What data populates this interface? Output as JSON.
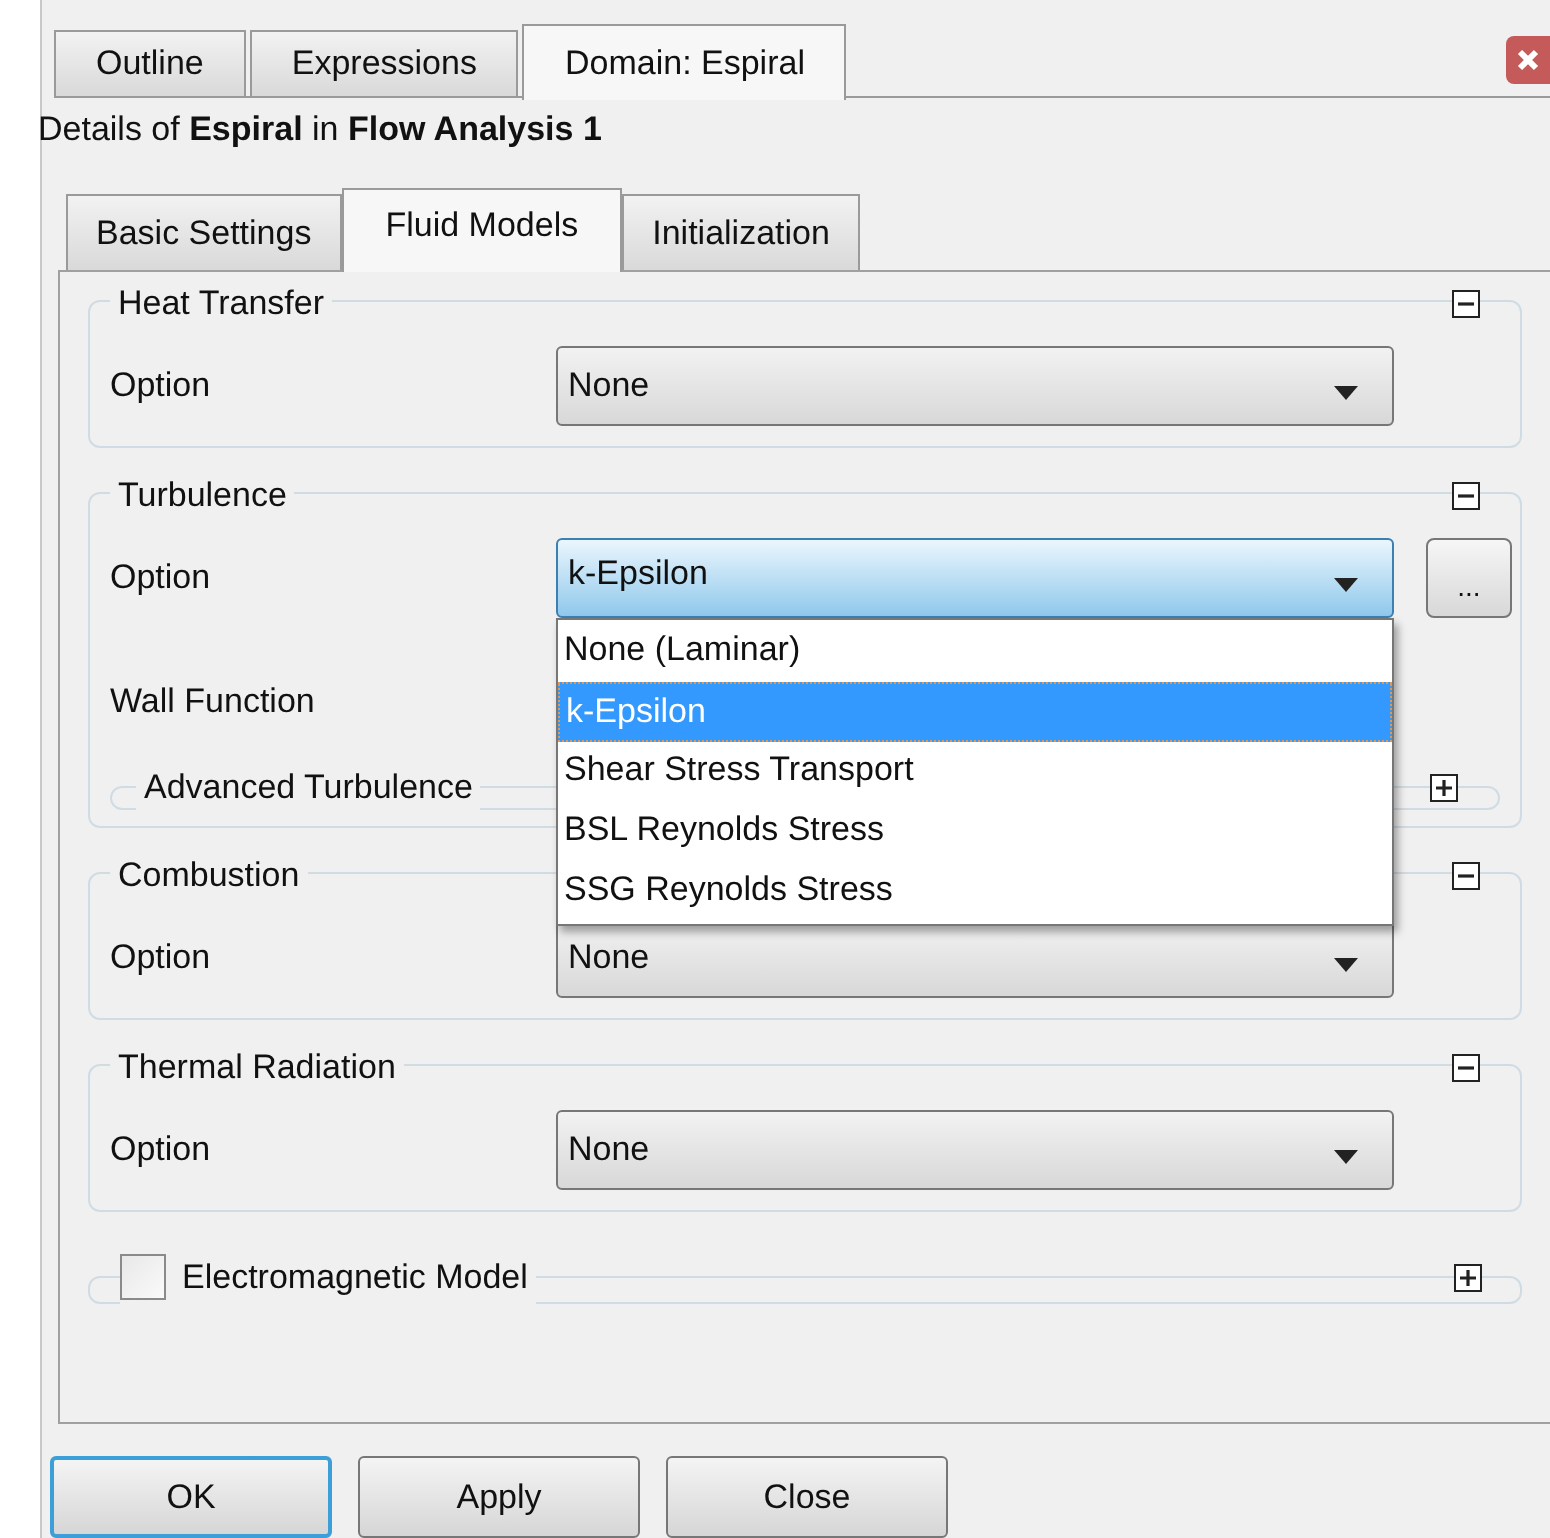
{
  "tabs": [
    {
      "label": "Outline",
      "selected": false
    },
    {
      "label": "Expressions",
      "selected": false
    },
    {
      "label": "Domain: Espiral",
      "selected": true
    }
  ],
  "details": "Details of **Espiral** in **Flow Analysis 1**",
  "subtabs": [
    {
      "label": "Basic Settings",
      "selected": false
    },
    {
      "label": "Fluid Models",
      "selected": true
    },
    {
      "label": "Initialization",
      "selected": false
    }
  ],
  "groups": [
    {
      "kind": "options",
      "title": "Heat Transfer",
      "expanded": true,
      "rows": [
        {
          "kind": "combo",
          "label": "Option",
          "value": "None",
          "focused": false
        }
      ]
    },
    {
      "kind": "options",
      "title": "Turbulence",
      "expanded": true,
      "rows": [
        {
          "kind": "combo",
          "label": "Option",
          "value": "k-Epsilon",
          "focused": true,
          "extra_button": "...",
          "dropdown": [
            {
              "label": "None (Laminar)",
              "selected": false
            },
            {
              "label": "k-Epsilon",
              "selected": true
            },
            {
              "label": "Shear Stress Transport",
              "selected": false
            },
            {
              "label": "BSL Reynolds Stress",
              "selected": false
            },
            {
              "label": "SSG Reynolds Stress",
              "selected": false
            }
          ]
        },
        {
          "kind": "label",
          "label": "Wall Function"
        }
      ],
      "subgroup": {
        "title": "Advanced Turbulence",
        "expanded": false
      }
    },
    {
      "kind": "options",
      "title": "Combustion",
      "expanded": true,
      "rows": [
        {
          "kind": "combo",
          "label": "Option",
          "value": "None",
          "focused": false
        }
      ]
    },
    {
      "kind": "options",
      "title": "Thermal Radiation",
      "expanded": true,
      "rows": [
        {
          "kind": "combo",
          "label": "Option",
          "value": "None",
          "focused": false
        }
      ]
    },
    {
      "kind": "checkbox",
      "title": "Electromagnetic Model",
      "checked": false,
      "expanded": false
    }
  ],
  "buttons": [
    {
      "label": "OK",
      "default": true
    },
    {
      "label": "Apply",
      "default": false
    },
    {
      "label": "Close",
      "default": false
    }
  ]
}
